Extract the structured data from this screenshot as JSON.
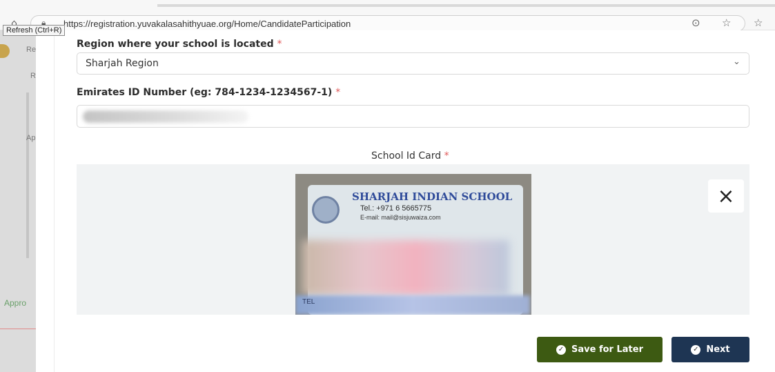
{
  "browser": {
    "url": "https://registration.yuvakalasahithyuae.org/Home/CandidateParticipation",
    "tooltip": "Refresh (Ctrl+R)",
    "icons": [
      "home-icon",
      "lock-icon",
      "reader-icon",
      "favorite-icon",
      "favorites-list-icon"
    ]
  },
  "sidebar": {
    "labels": [
      "Re",
      "R",
      "Ap",
      "Appro"
    ],
    "accent": "#c8a44d"
  },
  "form": {
    "region": {
      "label": "Region where your school is located",
      "required_mark": "*",
      "selected": "Sharjah Region"
    },
    "emirates_id": {
      "label": "Emirates ID Number (eg: 784-1234-1234567-1)",
      "required_mark": "*",
      "value": ""
    },
    "school_id_card": {
      "label": "School Id Card",
      "required_mark": "*",
      "image": {
        "school_name": "SHARJAH INDIAN SCHOOL",
        "tel": "Tel.: +971 6 5665775",
        "email": "E-mail: mail@sisjuwaiza.com",
        "tel_label": "TEL"
      }
    }
  },
  "actions": {
    "save_later": "Save for Later",
    "next": "Next"
  },
  "colors": {
    "save_button": "#3d5a12",
    "next_button": "#1e3553",
    "required": "#e05a5a"
  }
}
